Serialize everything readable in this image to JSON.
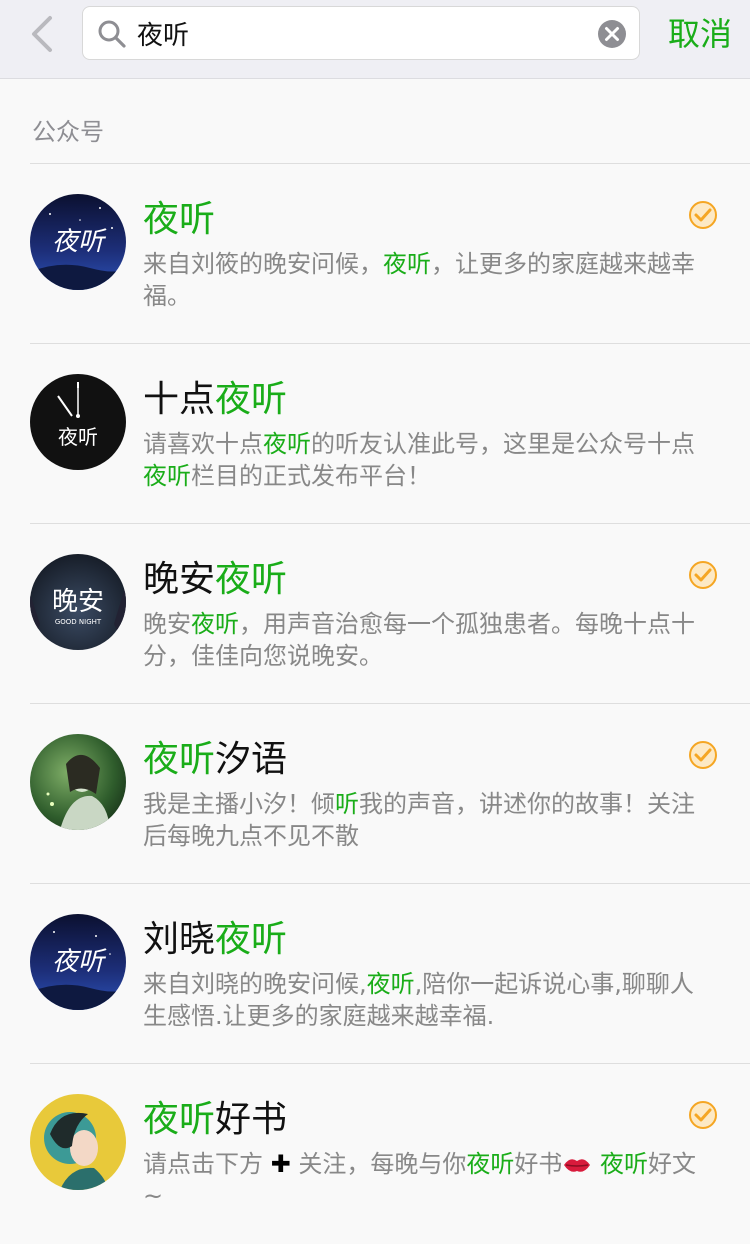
{
  "search": {
    "query": "夜听",
    "cancel_label": "取消"
  },
  "section": {
    "label": "公众号"
  },
  "accent_color": "#1aad19",
  "verified_color": "#f5a623",
  "results": [
    {
      "title_pre": "",
      "title_hl": "夜听",
      "title_post": "",
      "desc_a": "来自刘筱的晚安问候，",
      "desc_hl": "夜听",
      "desc_b": "，让更多的家庭越来越幸福。",
      "desc_c": "",
      "desc_hl2": "",
      "desc_d": "",
      "verified": true,
      "avatar_text": "夜听"
    },
    {
      "title_pre": "十点",
      "title_hl": "夜听",
      "title_post": "",
      "desc_a": "请喜欢十点",
      "desc_hl": "夜听",
      "desc_b": "的听友认准此号，这里是公众号十点",
      "desc_c": "",
      "desc_hl2": "夜听",
      "desc_d": "栏目的正式发布平台！",
      "verified": false,
      "avatar_text": "夜听"
    },
    {
      "title_pre": "晚安",
      "title_hl": "夜听",
      "title_post": "",
      "desc_a": "晚安",
      "desc_hl": "夜听",
      "desc_b": "，用声音治愈每一个孤独患者。每晚十点十分，佳佳向您说晚安。",
      "desc_c": "",
      "desc_hl2": "",
      "desc_d": "",
      "verified": true,
      "avatar_text": "晚安",
      "avatar_subtext": "GOOD NIGHT"
    },
    {
      "title_pre": "",
      "title_hl": "夜听",
      "title_post": "汐语",
      "desc_a": "我是主播小汐！倾",
      "desc_hl": "听",
      "desc_b": "我的声音，讲述你的故事！关注后每晚九点不见不散",
      "desc_c": "",
      "desc_hl2": "",
      "desc_d": "",
      "verified": true
    },
    {
      "title_pre": "刘晓",
      "title_hl": "夜听",
      "title_post": "",
      "desc_a": "来自刘晓的晚安问候,",
      "desc_hl": "夜听",
      "desc_b": ",陪你一起诉说心事,聊聊人生感悟.让更多的家庭越来越幸福.",
      "desc_c": "",
      "desc_hl2": "",
      "desc_d": "",
      "verified": false,
      "avatar_text": "夜听"
    },
    {
      "title_pre": "",
      "title_hl": "夜听",
      "title_post": "好书",
      "desc_a": "请点击下方 ",
      "desc_plus": "✚",
      "desc_b2": " 关注，每晚与你",
      "desc_hl": "夜听",
      "desc_b": "好书",
      "desc_emoji": "kiss-lips",
      "desc_hl2": "夜听",
      "desc_d": "好文~",
      "verified": true
    }
  ]
}
